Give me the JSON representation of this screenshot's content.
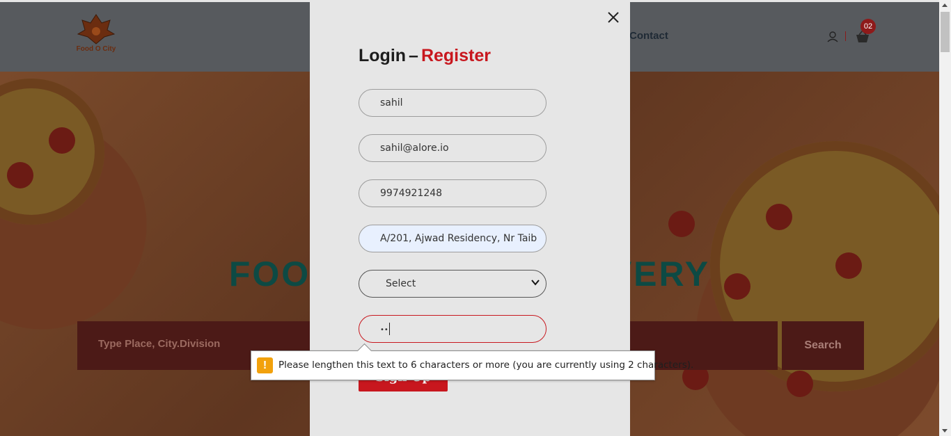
{
  "brand": {
    "name": "Food O City"
  },
  "nav": {
    "contact_label": "Contact",
    "cart_count": "02"
  },
  "hero": {
    "title": "FOOD                       VERY",
    "search_placeholder": "Type Place, City.Division",
    "search_button": "Search"
  },
  "modal": {
    "title_login": "Login",
    "title_dash": "–",
    "title_register": "Register",
    "fields": {
      "name": "sahil",
      "email": "sahil@alore.io",
      "phone": "9974921248",
      "address": "A/201, Ajwad Residency, Nr Taib",
      "select": "Select",
      "password": "••"
    },
    "signup_label": "Sign Up"
  },
  "tooltip": {
    "icon": "!",
    "message": "Please lengthen this text to 6 characters or more (you are currently using 2 characters)."
  },
  "colors": {
    "accent": "#c8171e",
    "header": "#575a5e",
    "modal_bg": "#e6e6e6",
    "warning": "#f2a10c"
  }
}
